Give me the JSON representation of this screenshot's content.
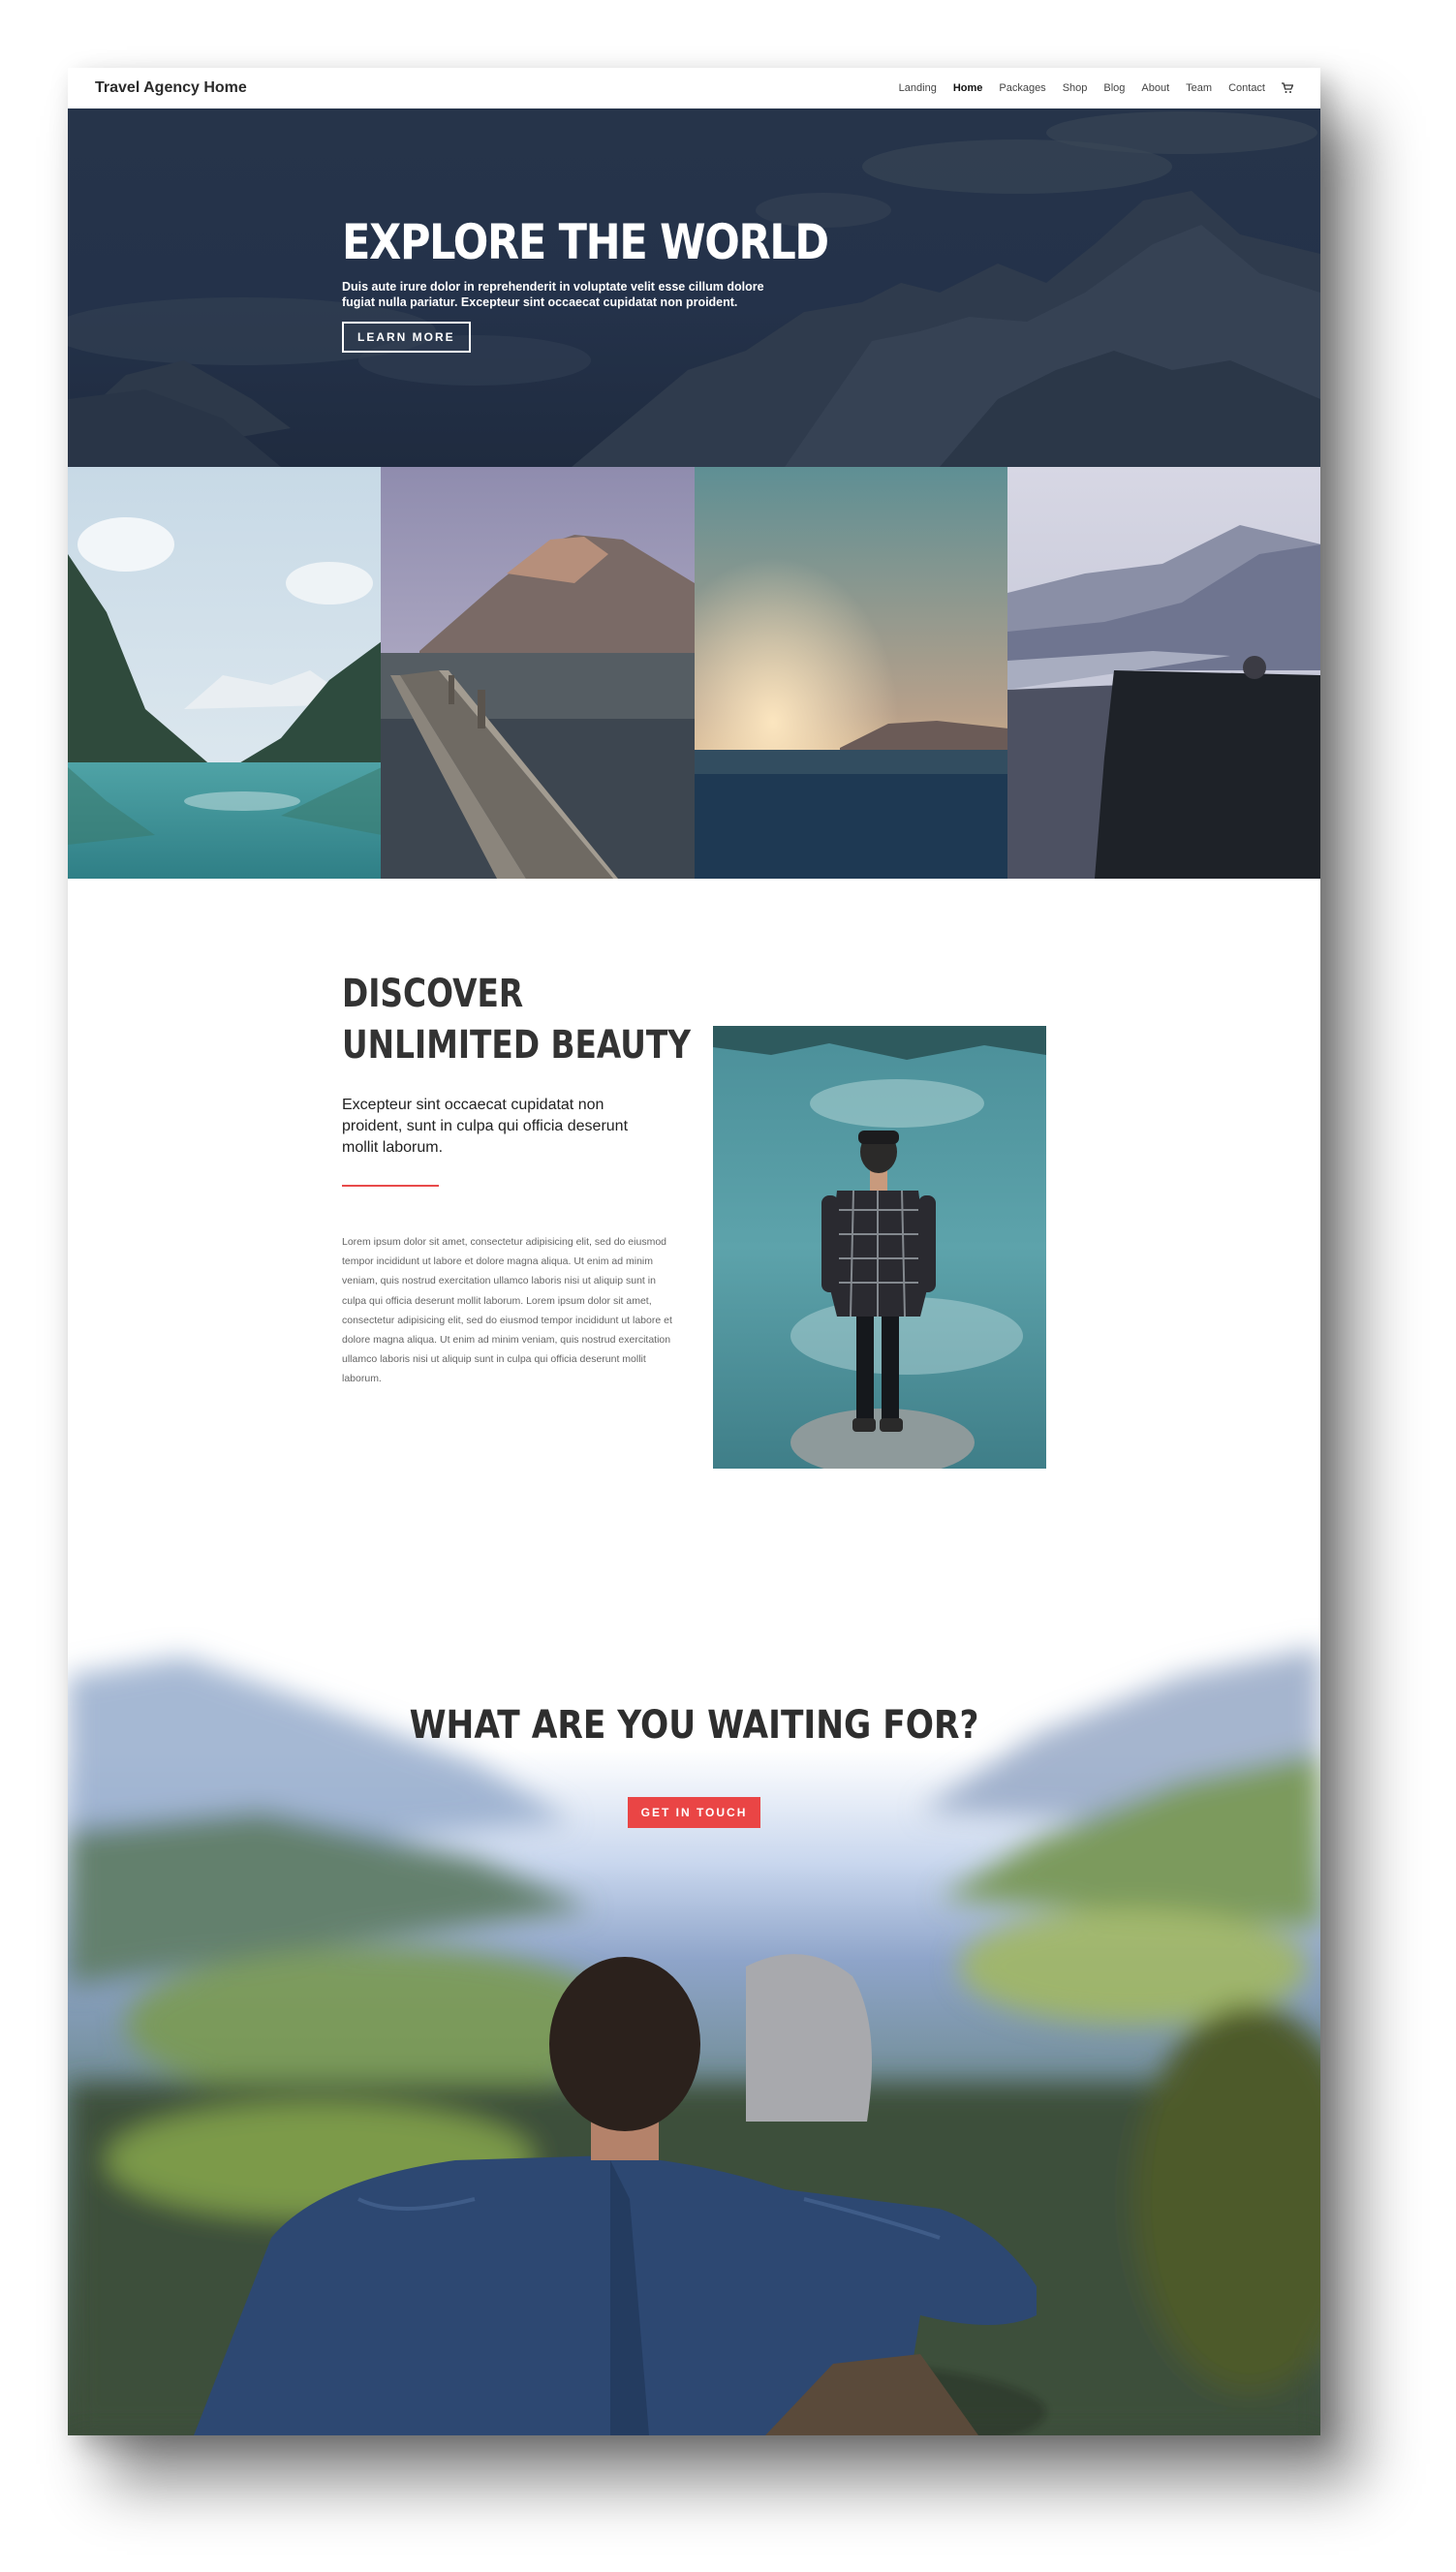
{
  "header": {
    "site_title": "Travel Agency Home",
    "nav": [
      "Landing",
      "Home",
      "Packages",
      "Shop",
      "Blog",
      "About",
      "Team",
      "Contact"
    ],
    "active_nav": "Home",
    "cart_icon": "cart-icon"
  },
  "hero": {
    "title": "EXPLORE THE WORLD",
    "text": "Duis aute irure dolor in reprehenderit in voluptate velit esse cillum dolore fugiat nulla pariatur. Excepteur sint occaecat cupidatat non proident.",
    "button": "LEARN MORE"
  },
  "discover": {
    "title_line1": "DISCOVER",
    "title_line2": "UNLIMITED BEAUTY",
    "subtitle": "Excepteur sint occaecat cupidatat non proident, sunt in culpa qui officia deserunt mollit laborum.",
    "body": "Lorem ipsum dolor sit amet, consectetur adipisicing elit, sed do eiusmod tempor incididunt ut labore et dolore magna aliqua. Ut enim ad minim veniam, quis nostrud exercitation ullamco laboris nisi ut aliquip sunt in culpa qui officia deserunt mollit laborum. Lorem ipsum dolor sit amet, consectetur adipisicing elit, sed do eiusmod tempor incididunt ut labore et dolore magna aliqua. Ut enim ad minim veniam, quis nostrud exercitation ullamco laboris nisi ut aliquip sunt in culpa qui officia deserunt mollit laborum."
  },
  "cta": {
    "title": "WHAT ARE YOU WAITING FOR?",
    "button": "GET IN TOUCH"
  },
  "colors": {
    "accent_red": "#ea4545",
    "hero_overlay": "#24324a",
    "heading_dark": "#333333"
  }
}
